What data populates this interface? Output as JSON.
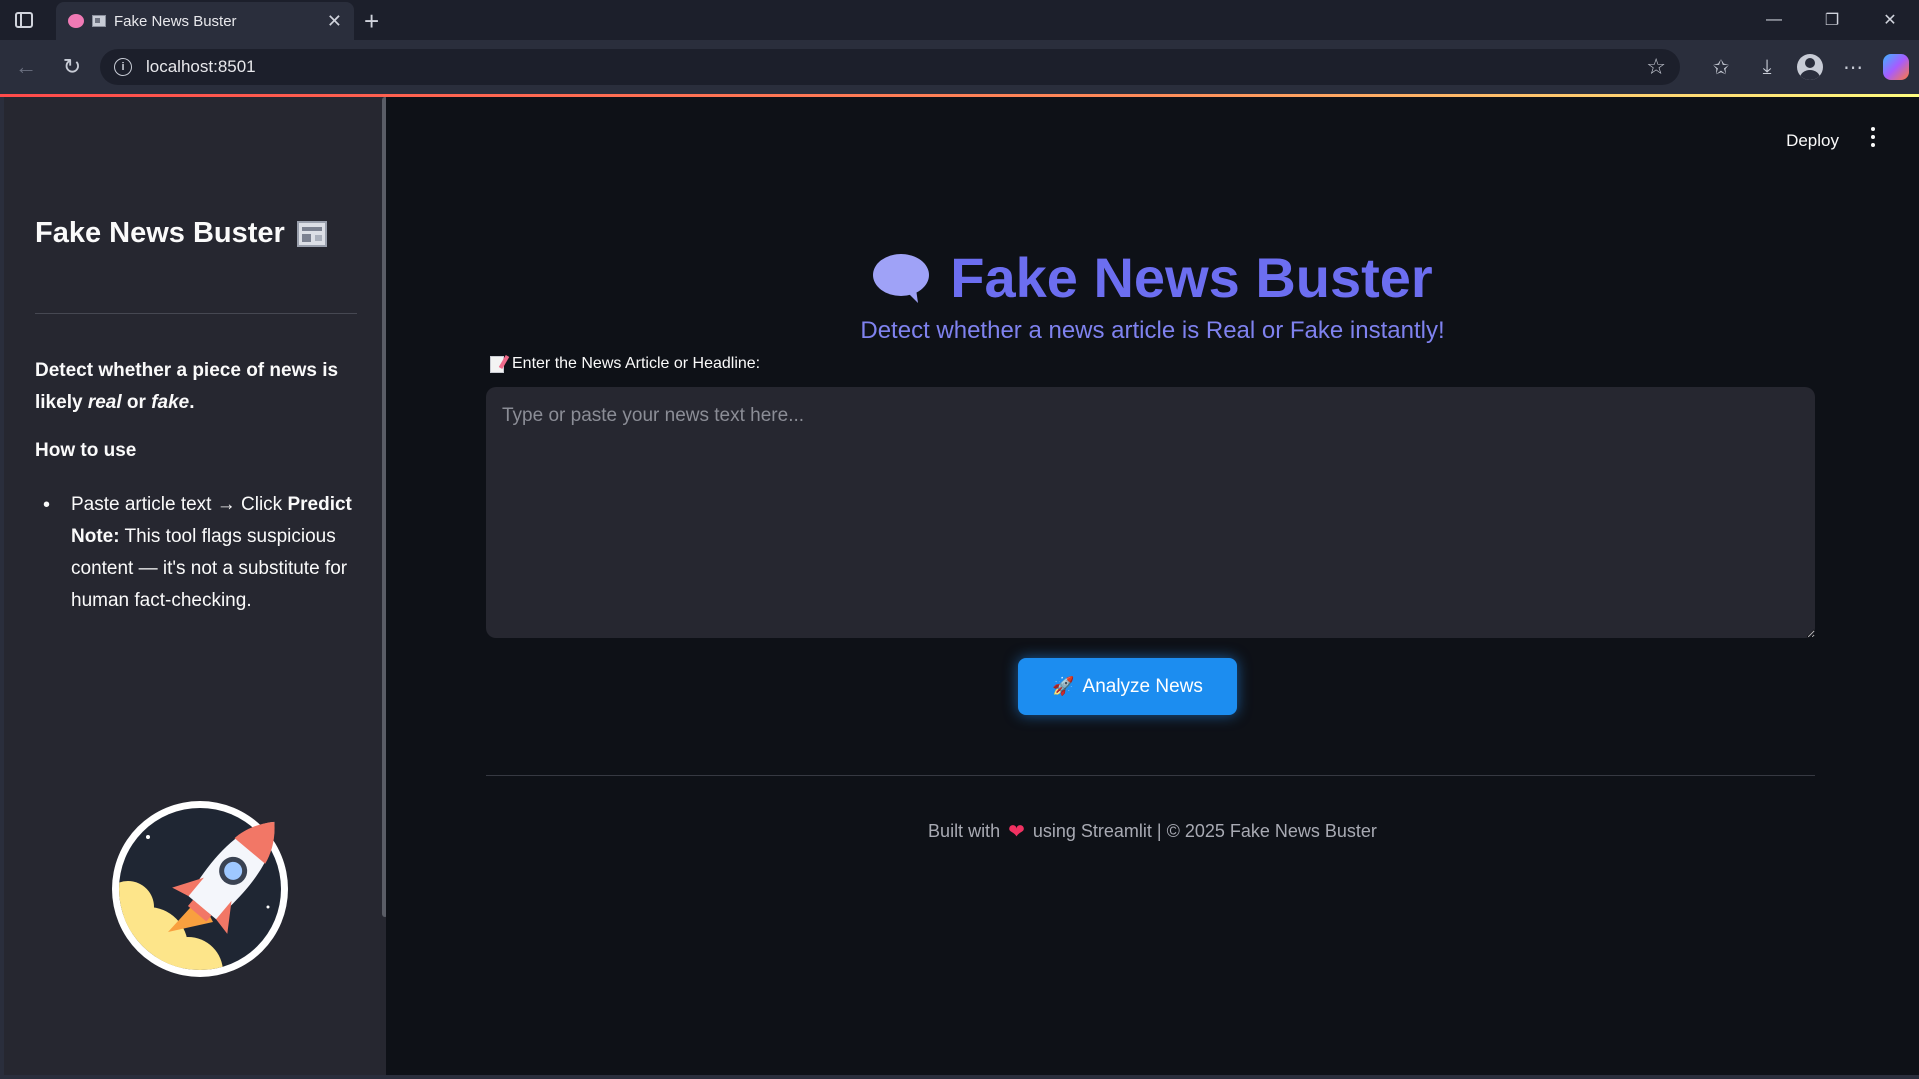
{
  "browser": {
    "tab_title": "Fake News Buster",
    "url": "localhost:8501"
  },
  "header": {
    "deploy_label": "Deploy"
  },
  "sidebar": {
    "title": "Fake News Buster",
    "desc_prefix": "Detect whether a piece of news is likely ",
    "desc_real": "real",
    "desc_or": " or ",
    "desc_fake": "fake",
    "desc_end": ".",
    "howto_heading": "How to use",
    "step_prefix": "Paste article text → Click ",
    "step_predict": "Predict",
    "note_label": "Note:",
    "note_text": " This tool flags suspicious content — it's not a substitute for human fact-checking."
  },
  "main": {
    "title": "Fake News Buster",
    "subtitle": "Detect whether a news article is Real or Fake instantly!",
    "input_label": "Enter the News Article or Headline:",
    "input_placeholder": "Type or paste your news text here...",
    "input_value": "",
    "analyze_label": "Analyze News",
    "footer_prefix": "Built with",
    "footer_suffix": "using Streamlit | © 2025 Fake News Buster"
  },
  "colors": {
    "accent": "#6c6ef0",
    "button": "#1c8df0",
    "sidebar_bg": "#262730",
    "main_bg": "#0e1117"
  }
}
